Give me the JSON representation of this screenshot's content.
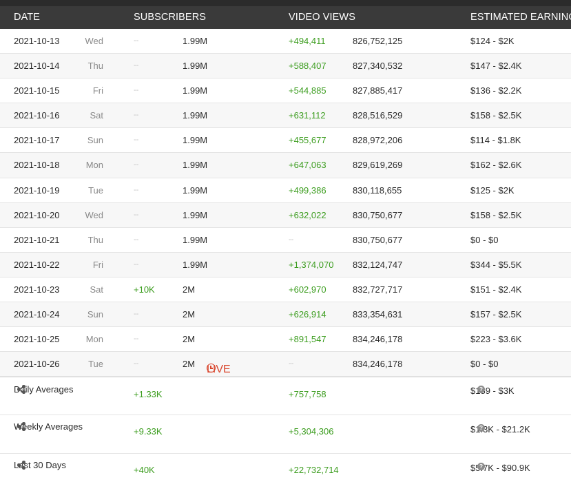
{
  "header": {
    "date": "DATE",
    "subscribers": "SUBSCRIBERS",
    "video_views": "VIDEO VIEWS",
    "earnings": "ESTIMATED EARNINGS"
  },
  "rows": [
    {
      "date": "2021-10-13",
      "dow": "Wed",
      "sub_change": "--",
      "sub_total": "1.99M",
      "view_change": "+494,411",
      "view_total": "826,752,125",
      "earnings": "$124  -  $2K"
    },
    {
      "date": "2021-10-14",
      "dow": "Thu",
      "sub_change": "--",
      "sub_total": "1.99M",
      "view_change": "+588,407",
      "view_total": "827,340,532",
      "earnings": "$147  -  $2.4K"
    },
    {
      "date": "2021-10-15",
      "dow": "Fri",
      "sub_change": "--",
      "sub_total": "1.99M",
      "view_change": "+544,885",
      "view_total": "827,885,417",
      "earnings": "$136  -  $2.2K"
    },
    {
      "date": "2021-10-16",
      "dow": "Sat",
      "sub_change": "--",
      "sub_total": "1.99M",
      "view_change": "+631,112",
      "view_total": "828,516,529",
      "earnings": "$158  -  $2.5K"
    },
    {
      "date": "2021-10-17",
      "dow": "Sun",
      "sub_change": "--",
      "sub_total": "1.99M",
      "view_change": "+455,677",
      "view_total": "828,972,206",
      "earnings": "$114  -  $1.8K"
    },
    {
      "date": "2021-10-18",
      "dow": "Mon",
      "sub_change": "--",
      "sub_total": "1.99M",
      "view_change": "+647,063",
      "view_total": "829,619,269",
      "earnings": "$162  -  $2.6K"
    },
    {
      "date": "2021-10-19",
      "dow": "Tue",
      "sub_change": "--",
      "sub_total": "1.99M",
      "view_change": "+499,386",
      "view_total": "830,118,655",
      "earnings": "$125  -  $2K"
    },
    {
      "date": "2021-10-20",
      "dow": "Wed",
      "sub_change": "--",
      "sub_total": "1.99M",
      "view_change": "+632,022",
      "view_total": "830,750,677",
      "earnings": "$158  -  $2.5K"
    },
    {
      "date": "2021-10-21",
      "dow": "Thu",
      "sub_change": "--",
      "sub_total": "1.99M",
      "view_change": "--",
      "view_total": "830,750,677",
      "earnings": "$0  -  $0"
    },
    {
      "date": "2021-10-22",
      "dow": "Fri",
      "sub_change": "--",
      "sub_total": "1.99M",
      "view_change": "+1,374,070",
      "view_total": "832,124,747",
      "earnings": "$344  -  $5.5K"
    },
    {
      "date": "2021-10-23",
      "dow": "Sat",
      "sub_change": "+10K",
      "sub_total": "2M",
      "view_change": "+602,970",
      "view_total": "832,727,717",
      "earnings": "$151  -  $2.4K"
    },
    {
      "date": "2021-10-24",
      "dow": "Sun",
      "sub_change": "--",
      "sub_total": "2M",
      "view_change": "+626,914",
      "view_total": "833,354,631",
      "earnings": "$157  -  $2.5K"
    },
    {
      "date": "2021-10-25",
      "dow": "Mon",
      "sub_change": "--",
      "sub_total": "2M",
      "view_change": "+891,547",
      "view_total": "834,246,178",
      "earnings": "$223  -  $3.6K"
    },
    {
      "date": "2021-10-26",
      "dow": "Tue",
      "sub_change": "--",
      "sub_total": "2M",
      "live": "LIVE",
      "view_change": "--",
      "view_total": "834,246,178",
      "earnings": "$0  -  $0"
    }
  ],
  "summary": [
    {
      "label": "Daily Averages",
      "sub_gain": "+1.33K",
      "view_gain": "+757,758",
      "earnings": "$189  -  $3K"
    },
    {
      "label": "Weekly Averages",
      "sub_gain": "+9.33K",
      "view_gain": "+5,304,306",
      "earnings": "$1.3K  -  $21.2K"
    },
    {
      "label": "Last 30 Days",
      "sub_gain": "+40K",
      "view_gain": "+22,732,714",
      "earnings": "$5.7K  -  $90.9K"
    }
  ],
  "icons": {
    "share": "share-icon",
    "help": "question-icon",
    "help_glyph": "?",
    "live_clock": "clock-icon"
  },
  "colors": {
    "header_bg": "#3a3a3a",
    "gain": "#3c9d1f",
    "live": "#d9452c"
  }
}
